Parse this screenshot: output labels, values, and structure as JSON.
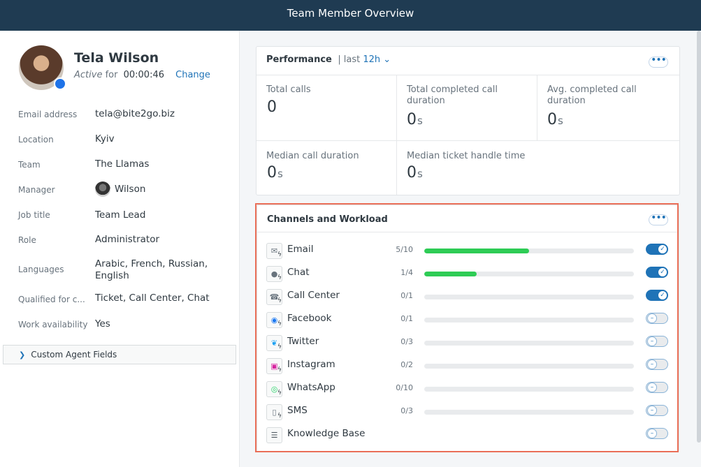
{
  "header": {
    "title": "Team Member Overview"
  },
  "profile": {
    "name": "Tela Wilson",
    "status": "Active",
    "for_text": "for",
    "timer": "00:00:46",
    "change_label": "Change",
    "fields": [
      {
        "label": "Email address",
        "value": "tela@bite2go.biz"
      },
      {
        "label": "Location",
        "value": "Kyiv"
      },
      {
        "label": "Team",
        "value": "The Llamas"
      },
      {
        "label": "Manager",
        "value": "Wilson"
      },
      {
        "label": "Job title",
        "value": "Team Lead"
      },
      {
        "label": "Role",
        "value": "Administrator"
      },
      {
        "label": "Languages",
        "value": "Arabic, French, Russian, English"
      },
      {
        "label": "Qualified for c...",
        "value": "Ticket, Call Center, Chat"
      },
      {
        "label": "Work availability",
        "value": "Yes"
      }
    ],
    "custom_fields_label": "Custom Agent Fields"
  },
  "performance": {
    "title": "Performance",
    "period_prefix": "last",
    "period_value": "12h",
    "metrics": [
      {
        "label": "Total calls",
        "value": "0",
        "unit": ""
      },
      {
        "label": "Total completed call duration",
        "value": "0",
        "unit": "s"
      },
      {
        "label": "Avg. completed call duration",
        "value": "0",
        "unit": "s"
      },
      {
        "label": "Median call duration",
        "value": "0",
        "unit": "s"
      },
      {
        "label": "Median ticket handle time",
        "value": "0",
        "unit": "s"
      }
    ]
  },
  "channels": {
    "title": "Channels and Workload",
    "items": [
      {
        "name": "Email",
        "capacity": "5/10",
        "load": 0.5,
        "enabled": true,
        "icon": "email-icon"
      },
      {
        "name": "Chat",
        "capacity": "1/4",
        "load": 0.25,
        "enabled": true,
        "icon": "chat-icon"
      },
      {
        "name": "Call Center",
        "capacity": "0/1",
        "load": 0,
        "enabled": true,
        "icon": "phone-icon"
      },
      {
        "name": "Facebook",
        "capacity": "0/1",
        "load": 0,
        "enabled": false,
        "icon": "messenger-icon"
      },
      {
        "name": "Twitter",
        "capacity": "0/3",
        "load": 0,
        "enabled": false,
        "icon": "twitter-icon"
      },
      {
        "name": "Instagram",
        "capacity": "0/2",
        "load": 0,
        "enabled": false,
        "icon": "instagram-icon"
      },
      {
        "name": "WhatsApp",
        "capacity": "0/10",
        "load": 0,
        "enabled": false,
        "icon": "whatsapp-icon"
      },
      {
        "name": "SMS",
        "capacity": "0/3",
        "load": 0,
        "enabled": false,
        "icon": "sms-icon"
      },
      {
        "name": "Knowledge Base",
        "capacity": "",
        "load": null,
        "enabled": false,
        "icon": "knowledge-base-icon"
      }
    ],
    "colors": {
      "load_fill": "#2ecc55",
      "toggle_on": "#1f73b7",
      "highlight": "#ea6f58"
    }
  }
}
